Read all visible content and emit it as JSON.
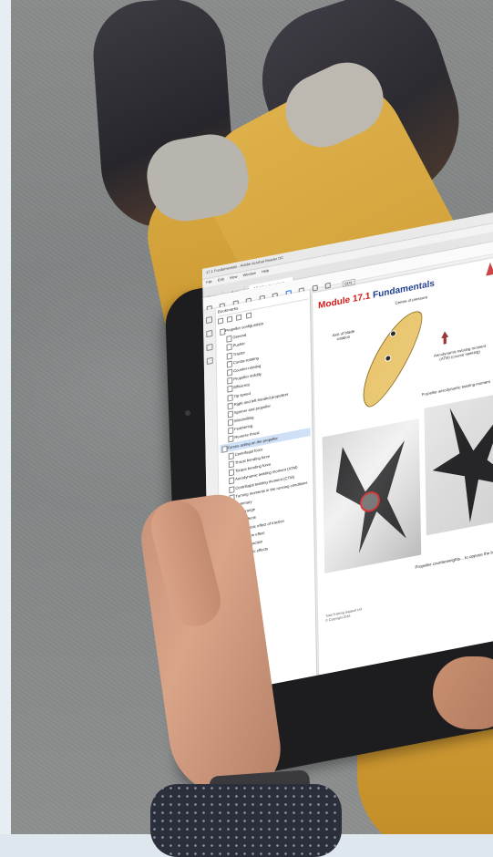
{
  "scene": {
    "description_tag": "photo-tablet-pdf-reader"
  },
  "app": {
    "window_title": "17.1 Fundamentals - Adobe Acrobat Reader DC",
    "menu": [
      "File",
      "Edit",
      "View",
      "Window",
      "Help"
    ],
    "tabs": [
      {
        "label": "Home"
      },
      {
        "label": "Tools"
      },
      {
        "label": "17.1 Fundamentals..."
      }
    ],
    "toolbar": {
      "zoom": "61%"
    }
  },
  "sidebar": {
    "panel_title": "Bookmarks",
    "items": [
      {
        "label": "Propeller configuration",
        "level": 0
      },
      {
        "label": "General",
        "level": 1
      },
      {
        "label": "Pusher",
        "level": 1
      },
      {
        "label": "Tractor",
        "level": 1
      },
      {
        "label": "Contra-rotating",
        "level": 1
      },
      {
        "label": "Counter-rotating",
        "level": 1
      },
      {
        "label": "Propeller solidity",
        "level": 1
      },
      {
        "label": "Efficiency",
        "level": 1
      },
      {
        "label": "Tip speed",
        "level": 1
      },
      {
        "label": "Right and left-handed propellers",
        "level": 1
      },
      {
        "label": "Spinner and propeller",
        "level": 1
      },
      {
        "label": "Windmilling",
        "level": 1
      },
      {
        "label": "Feathering",
        "level": 1
      },
      {
        "label": "Reverse thrust",
        "level": 1
      },
      {
        "label": "Forces acting on the propeller",
        "level": 0,
        "selected": true
      },
      {
        "label": "Centrifugal force",
        "level": 1
      },
      {
        "label": "Thrust bending force",
        "level": 1
      },
      {
        "label": "Torque bending force",
        "level": 1
      },
      {
        "label": "Aerodynamic twisting moment (ATM)",
        "level": 1
      },
      {
        "label": "Centrifugal twisting moment (CTM)",
        "level": 1
      },
      {
        "label": "Turning moments in the running conditions",
        "level": 1
      },
      {
        "label": "Summary",
        "level": 1
      },
      {
        "label": "Pitch range",
        "level": 1
      },
      {
        "label": "Vibration effects",
        "level": 0
      },
      {
        "label": "Asymmetric effect of traction",
        "level": 1
      },
      {
        "label": "Slipstream effect",
        "level": 1
      },
      {
        "label": "Torque reaction",
        "level": 1
      },
      {
        "label": "Gyroscopic effects",
        "level": 1
      }
    ]
  },
  "document": {
    "title_prefix": "Module ",
    "title_number": "17.1",
    "title_word": " Fundamentals",
    "labels": {
      "centre_of_pressure": "Centre of pressure",
      "axis_of_blade_rotation": "Axis of blade rotation",
      "atm": "Aerodynamic twisting moment (ATM) (course seeking)",
      "propeller_atm": "Propeller aerodynamic twisting moment"
    },
    "caption": "Propeller counterweights... to oppose the blade's natural...",
    "footer_line1": "Total Training Support Ltd",
    "footer_line2": "© Copyright 2016"
  },
  "colors": {
    "title_red": "#d41919",
    "title_blue": "#1c3c8f",
    "trousers": "#d6a740",
    "highlight_circle": "#d32020"
  }
}
